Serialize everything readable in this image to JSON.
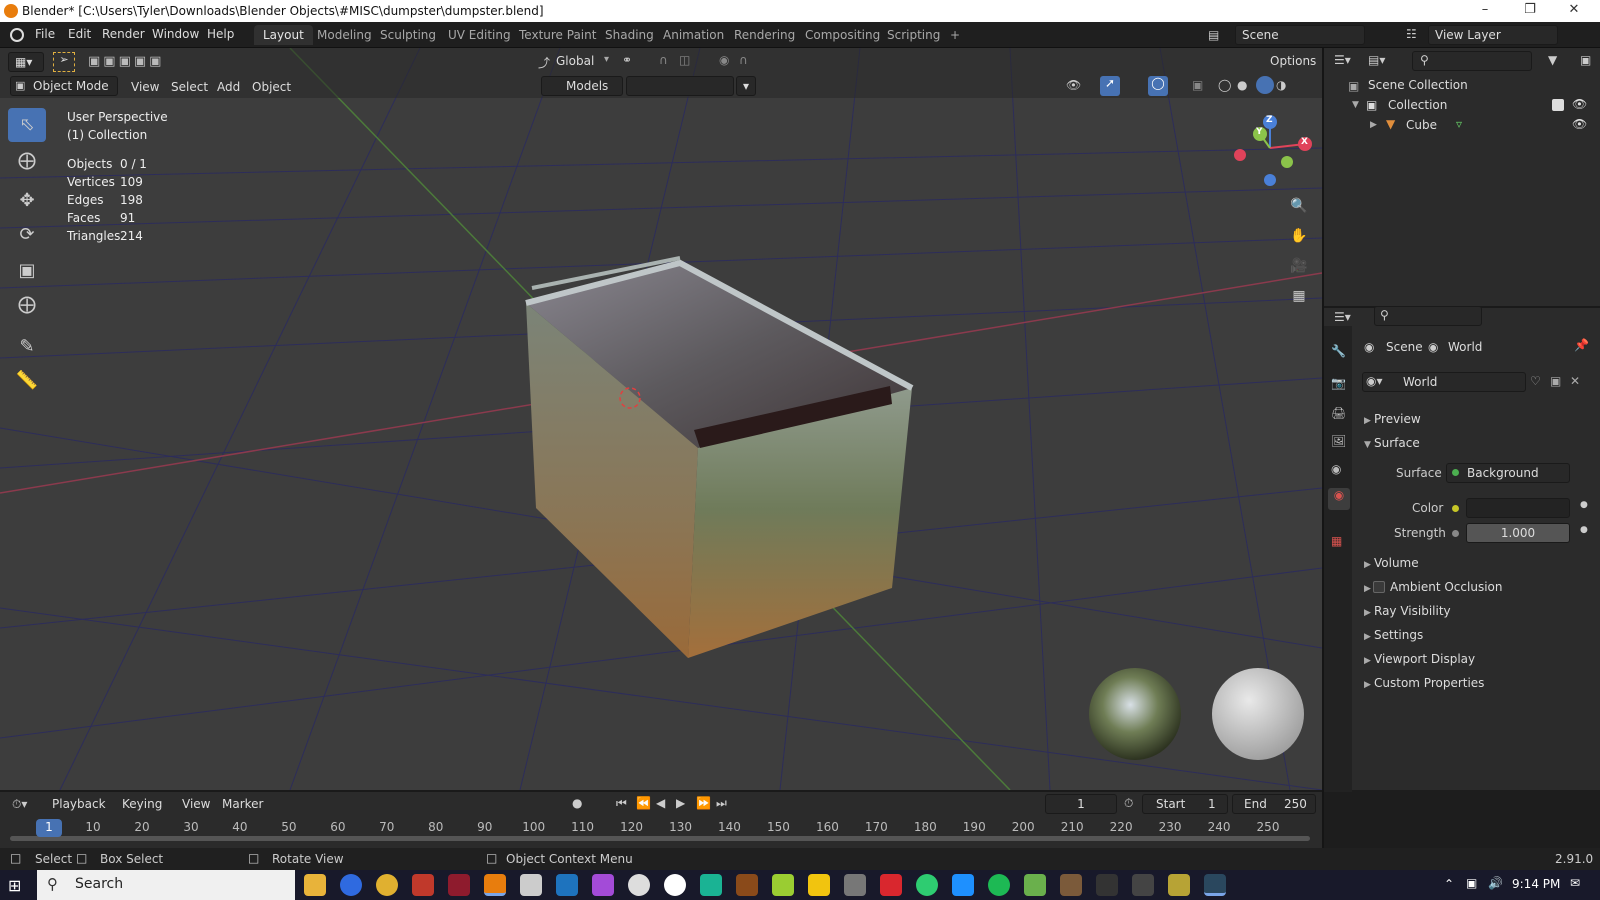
{
  "titlebar": {
    "title": "Blender* [C:\\Users\\Tyler\\Downloads\\Blender Objects\\#MISC\\dumpster\\dumpster.blend]",
    "minimize_icon": "minimize-icon",
    "maximize_icon": "restore-icon",
    "close_icon": "close-icon"
  },
  "menubar": {
    "menus": [
      "File",
      "Edit",
      "Render",
      "Window",
      "Help"
    ],
    "workspaces": [
      "Layout",
      "Modeling",
      "Sculpting",
      "UV Editing",
      "Texture Paint",
      "Shading",
      "Animation",
      "Rendering",
      "Compositing",
      "Scripting"
    ],
    "active_workspace": "Layout",
    "add_workspace": "+",
    "scene_label": "Scene",
    "view_layer_label": "View Layer"
  },
  "viewport_header": {
    "transform_orientation": "Global",
    "options_label": "Options",
    "mode": "Object Mode",
    "menus": [
      "View",
      "Select",
      "Add",
      "Object"
    ],
    "collection_dropdown": "Models"
  },
  "viewport_overlay": {
    "perspective": "User Perspective",
    "collection": "(1) Collection",
    "stats": [
      {
        "label": "Objects",
        "value": "0 / 1"
      },
      {
        "label": "Vertices",
        "value": "109"
      },
      {
        "label": "Edges",
        "value": "198"
      },
      {
        "label": "Faces",
        "value": "91"
      },
      {
        "label": "Triangles",
        "value": "214"
      }
    ]
  },
  "gizmo": {
    "x": "X",
    "y": "Y",
    "z": "Z"
  },
  "outliner": {
    "scene_collection": "Scene Collection",
    "collection": "Collection",
    "cube": "Cube"
  },
  "properties": {
    "breadcrumb_scene": "Scene",
    "breadcrumb_world": "World",
    "world_name": "World",
    "panels": {
      "preview": "Preview",
      "surface": "Surface",
      "volume": "Volume",
      "ambient_occlusion": "Ambient Occlusion",
      "ray_visibility": "Ray Visibility",
      "settings": "Settings",
      "viewport_display": "Viewport Display",
      "custom_properties": "Custom Properties"
    },
    "surface_label": "Surface",
    "surface_value": "Background",
    "color_label": "Color",
    "strength_label": "Strength",
    "strength_value": "1.000"
  },
  "timeline": {
    "menus": [
      "Playback",
      "Keying",
      "View",
      "Marker"
    ],
    "current_frame": "1",
    "start_label": "Start",
    "start_value": "1",
    "end_label": "End",
    "end_value": "250",
    "ticks": [
      "1",
      "10",
      "20",
      "30",
      "40",
      "50",
      "60",
      "70",
      "80",
      "90",
      "100",
      "110",
      "120",
      "130",
      "140",
      "150",
      "160",
      "170",
      "180",
      "190",
      "200",
      "210",
      "220",
      "230",
      "240",
      "250"
    ]
  },
  "statusbar": {
    "select": "Select",
    "box_select": "Box Select",
    "rotate_view": "Rotate View",
    "context_menu": "Object Context Menu",
    "version": "2.91.0"
  },
  "taskbar": {
    "search_placeholder": "Search",
    "time": "9:14 PM"
  },
  "colors": {
    "accent": "#4772b3",
    "x_axis": "#e0435a",
    "y_axis": "#8bc34a",
    "z_axis": "#4a80d8",
    "world_icon": "#d9534f"
  }
}
